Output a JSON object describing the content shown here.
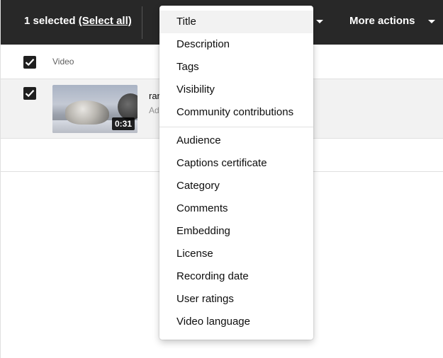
{
  "actionbar": {
    "selected_text": "1 selected",
    "select_all_label": "(Select all)",
    "more_actions_label": "More actions"
  },
  "table": {
    "header_label": "Video",
    "video": {
      "duration": "0:31",
      "title_fragment": "ran",
      "description_fragment": "Ad"
    }
  },
  "edit_menu": {
    "group1": [
      "Title",
      "Description",
      "Tags",
      "Visibility",
      "Community contributions"
    ],
    "group2": [
      "Audience",
      "Captions certificate",
      "Category",
      "Comments",
      "Embedding",
      "License",
      "Recording date",
      "User ratings",
      "Video language"
    ],
    "highlighted": "Title"
  },
  "icons": {
    "checkbox": "checkbox-checked-icon",
    "caret": "caret-down-icon"
  }
}
